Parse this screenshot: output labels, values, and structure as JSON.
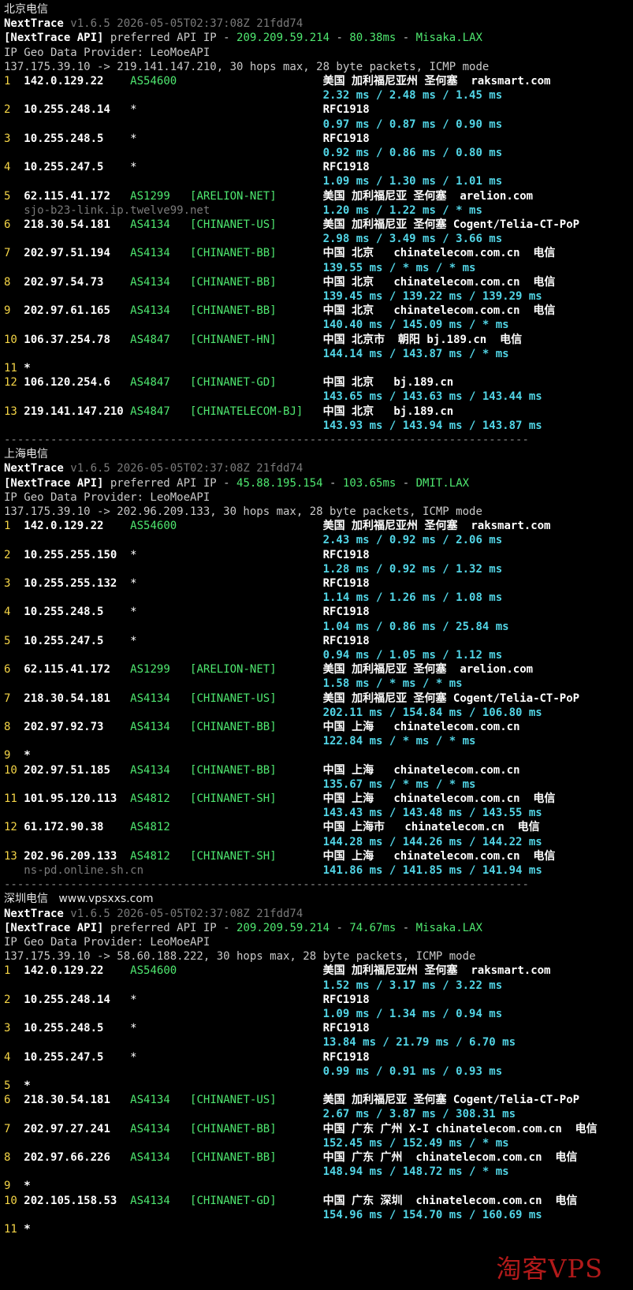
{
  "colors": {
    "background": "#000000",
    "hop_index": "#f5d547",
    "asn": "#4fe870",
    "rtt": "#52d5e6",
    "version": "#7a7a7a",
    "watermark": "#d21f1f"
  },
  "sections": [
    {
      "title": "北京电信",
      "nexttrace": "NextTrace",
      "version": " v1.6.5 2026-05-05T02:37:08Z 21fdd74",
      "api_prefix": "[NextTrace API]",
      "api_text": " preferred API IP - ",
      "api_ip": "209.209.59.214",
      "api_sep1": " - ",
      "api_ms": "80.38ms",
      "api_sep2": " - ",
      "api_node": "Misaka.LAX",
      "geo": "IP Geo Data Provider: LeoMoeAPI",
      "route": "137.175.39.10 -> 219.141.147.210, 30 hops max, 28 byte packets, ICMP mode",
      "hops": [
        {
          "n": "1",
          "ip": "142.0.129.22",
          "as": "AS54600",
          "tag": "",
          "geo": "美国 加利福尼亚州 圣何塞  raksmart.com",
          "rtt": "2.32 ms / 2.48 ms / 1.45 ms"
        },
        {
          "n": "2",
          "ip": "10.255.248.14",
          "as": "*",
          "tag": "",
          "geo": "RFC1918",
          "rtt": "0.97 ms / 0.87 ms / 0.90 ms"
        },
        {
          "n": "3",
          "ip": "10.255.248.5",
          "as": "*",
          "tag": "",
          "geo": "RFC1918",
          "rtt": "0.92 ms / 0.86 ms / 0.80 ms"
        },
        {
          "n": "4",
          "ip": "10.255.247.5",
          "as": "*",
          "tag": "",
          "geo": "RFC1918",
          "rtt": "1.09 ms / 1.30 ms / 1.01 ms"
        },
        {
          "n": "5",
          "ip": "62.115.41.172",
          "as": "AS1299",
          "tag": "[ARELION-NET]",
          "geo": "美国 加利福尼亚 圣何塞  arelion.com",
          "rtt": "1.20 ms / 1.22 ms / * ms",
          "host": "sjo-b23-link.ip.twelve99.net"
        },
        {
          "n": "6",
          "ip": "218.30.54.181",
          "as": "AS4134",
          "tag": "[CHINANET-US]",
          "geo": "美国 加利福尼亚 圣何塞 Cogent/Telia-CT-PoP",
          "rtt": "2.98 ms / 3.49 ms / 3.66 ms"
        },
        {
          "n": "7",
          "ip": "202.97.51.194",
          "as": "AS4134",
          "tag": "[CHINANET-BB]",
          "geo": "中国 北京   chinatelecom.com.cn  电信",
          "rtt": "139.55 ms / * ms / * ms"
        },
        {
          "n": "8",
          "ip": "202.97.54.73",
          "as": "AS4134",
          "tag": "[CHINANET-BB]",
          "geo": "中国 北京   chinatelecom.com.cn  电信",
          "rtt": "139.45 ms / 139.22 ms / 139.29 ms"
        },
        {
          "n": "9",
          "ip": "202.97.61.165",
          "as": "AS4134",
          "tag": "[CHINANET-BB]",
          "geo": "中国 北京   chinatelecom.com.cn  电信",
          "rtt": "140.40 ms / 145.09 ms / * ms"
        },
        {
          "n": "10",
          "ip": "106.37.254.78",
          "as": "AS4847",
          "tag": "[CHINANET-HN]",
          "geo": "中国 北京市  朝阳 bj.189.cn  电信",
          "rtt": "144.14 ms / 143.87 ms / * ms"
        },
        {
          "n": "11",
          "ip": "*",
          "as": "",
          "tag": "",
          "geo": "",
          "rtt": ""
        },
        {
          "n": "12",
          "ip": "106.120.254.6",
          "as": "AS4847",
          "tag": "[CHINANET-GD]",
          "geo": "中国 北京   bj.189.cn",
          "rtt": "143.65 ms / 143.63 ms / 143.44 ms"
        },
        {
          "n": "13",
          "ip": "219.141.147.210",
          "as": "AS4847",
          "tag": "[CHINATELECOM-BJ]",
          "geo": "中国 北京   bj.189.cn",
          "rtt": "143.93 ms / 143.94 ms / 143.87 ms"
        }
      ]
    },
    {
      "title": "上海电信",
      "nexttrace": "NextTrace",
      "version": " v1.6.5 2026-05-05T02:37:08Z 21fdd74",
      "api_prefix": "[NextTrace API]",
      "api_text": " preferred API IP - ",
      "api_ip": "45.88.195.154",
      "api_sep1": " - ",
      "api_ms": "103.65ms",
      "api_sep2": " - ",
      "api_node": "DMIT.LAX",
      "geo": "IP Geo Data Provider: LeoMoeAPI",
      "route": "137.175.39.10 -> 202.96.209.133, 30 hops max, 28 byte packets, ICMP mode",
      "hops": [
        {
          "n": "1",
          "ip": "142.0.129.22",
          "as": "AS54600",
          "tag": "",
          "geo": "美国 加利福尼亚州 圣何塞  raksmart.com",
          "rtt": "2.43 ms / 0.92 ms / 2.06 ms"
        },
        {
          "n": "2",
          "ip": "10.255.255.150",
          "as": "*",
          "tag": "",
          "geo": "RFC1918",
          "rtt": "1.28 ms / 0.92 ms / 1.32 ms"
        },
        {
          "n": "3",
          "ip": "10.255.255.132",
          "as": "*",
          "tag": "",
          "geo": "RFC1918",
          "rtt": "1.14 ms / 1.26 ms / 1.08 ms"
        },
        {
          "n": "4",
          "ip": "10.255.248.5",
          "as": "*",
          "tag": "",
          "geo": "RFC1918",
          "rtt": "1.04 ms / 0.86 ms / 25.84 ms"
        },
        {
          "n": "5",
          "ip": "10.255.247.5",
          "as": "*",
          "tag": "",
          "geo": "RFC1918",
          "rtt": "0.94 ms / 1.05 ms / 1.12 ms"
        },
        {
          "n": "6",
          "ip": "62.115.41.172",
          "as": "AS1299",
          "tag": "[ARELION-NET]",
          "geo": "美国 加利福尼亚 圣何塞  arelion.com",
          "rtt": "1.58 ms / * ms / * ms"
        },
        {
          "n": "7",
          "ip": "218.30.54.181",
          "as": "AS4134",
          "tag": "[CHINANET-US]",
          "geo": "美国 加利福尼亚 圣何塞 Cogent/Telia-CT-PoP",
          "rtt": "202.11 ms / 154.84 ms / 106.80 ms"
        },
        {
          "n": "8",
          "ip": "202.97.92.73",
          "as": "AS4134",
          "tag": "[CHINANET-BB]",
          "geo": "中国 上海   chinatelecom.com.cn",
          "rtt": "122.84 ms / * ms / * ms"
        },
        {
          "n": "9",
          "ip": "*",
          "as": "",
          "tag": "",
          "geo": "",
          "rtt": ""
        },
        {
          "n": "10",
          "ip": "202.97.51.185",
          "as": "AS4134",
          "tag": "[CHINANET-BB]",
          "geo": "中国 上海   chinatelecom.com.cn",
          "rtt": "135.67 ms / * ms / * ms"
        },
        {
          "n": "11",
          "ip": "101.95.120.113",
          "as": "AS4812",
          "tag": "[CHINANET-SH]",
          "geo": "中国 上海   chinatelecom.com.cn  电信",
          "rtt": "143.43 ms / 143.48 ms / 143.55 ms"
        },
        {
          "n": "12",
          "ip": "61.172.90.38",
          "as": "AS4812",
          "tag": "",
          "geo": "中国 上海市   chinatelecom.cn  电信",
          "rtt": "144.28 ms / 144.26 ms / 144.22 ms"
        },
        {
          "n": "13",
          "ip": "202.96.209.133",
          "as": "AS4812",
          "tag": "[CHINANET-SH]",
          "geo": "中国 上海   chinatelecom.com.cn  电信",
          "rtt": "141.86 ms / 141.85 ms / 141.94 ms",
          "host": "ns-pd.online.sh.cn"
        }
      ]
    },
    {
      "title": "深圳电信   www.vpsxxs.com",
      "nexttrace": "NextTrace",
      "version": " v1.6.5 2026-05-05T02:37:08Z 21fdd74",
      "api_prefix": "[NextTrace API]",
      "api_text": " preferred API IP - ",
      "api_ip": "209.209.59.214",
      "api_sep1": " - ",
      "api_ms": "74.67ms",
      "api_sep2": " - ",
      "api_node": "Misaka.LAX",
      "geo": "IP Geo Data Provider: LeoMoeAPI",
      "route": "137.175.39.10 -> 58.60.188.222, 30 hops max, 28 byte packets, ICMP mode",
      "hops": [
        {
          "n": "1",
          "ip": "142.0.129.22",
          "as": "AS54600",
          "tag": "",
          "geo": "美国 加利福尼亚州 圣何塞  raksmart.com",
          "rtt": "1.52 ms / 3.17 ms / 3.22 ms"
        },
        {
          "n": "2",
          "ip": "10.255.248.14",
          "as": "*",
          "tag": "",
          "geo": "RFC1918",
          "rtt": "1.09 ms / 1.34 ms / 0.94 ms"
        },
        {
          "n": "3",
          "ip": "10.255.248.5",
          "as": "*",
          "tag": "",
          "geo": "RFC1918",
          "rtt": "13.84 ms / 21.79 ms / 6.70 ms"
        },
        {
          "n": "4",
          "ip": "10.255.247.5",
          "as": "*",
          "tag": "",
          "geo": "RFC1918",
          "rtt": "0.99 ms / 0.91 ms / 0.93 ms"
        },
        {
          "n": "5",
          "ip": "*",
          "as": "",
          "tag": "",
          "geo": "",
          "rtt": ""
        },
        {
          "n": "6",
          "ip": "218.30.54.181",
          "as": "AS4134",
          "tag": "[CHINANET-US]",
          "geo": "美国 加利福尼亚 圣何塞 Cogent/Telia-CT-PoP",
          "rtt": "2.67 ms / 3.87 ms / 308.31 ms"
        },
        {
          "n": "7",
          "ip": "202.97.27.241",
          "as": "AS4134",
          "tag": "[CHINANET-BB]",
          "geo": "中国 广东 广州 X-I chinatelecom.com.cn  电信",
          "rtt": "152.45 ms / 152.49 ms / * ms"
        },
        {
          "n": "8",
          "ip": "202.97.66.226",
          "as": "AS4134",
          "tag": "[CHINANET-BB]",
          "geo": "中国 广东 广州  chinatelecom.com.cn  电信",
          "rtt": "148.94 ms / 148.72 ms / * ms"
        },
        {
          "n": "9",
          "ip": "*",
          "as": "",
          "tag": "",
          "geo": "",
          "rtt": ""
        },
        {
          "n": "10",
          "ip": "202.105.158.53",
          "as": "AS4134",
          "tag": "[CHINANET-GD]",
          "geo": "中国 广东 深圳  chinatelecom.com.cn  电信",
          "rtt": "154.96 ms / 154.70 ms / 160.69 ms"
        },
        {
          "n": "11",
          "ip": "*",
          "as": "",
          "tag": "",
          "geo": "",
          "rtt": ""
        }
      ]
    }
  ],
  "separator": "-------------------------------------------------------------------------------",
  "watermark": "淘客VPS"
}
